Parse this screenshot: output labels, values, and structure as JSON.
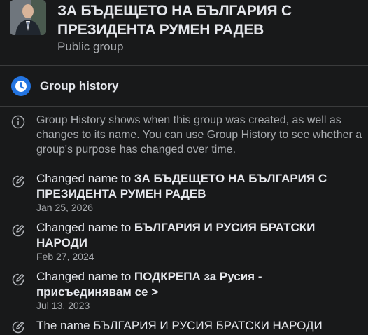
{
  "group": {
    "title": "ЗА БЪДЕЩЕТО НА БЪЛГАРИЯ С ПРЕЗИДЕНТА РУМЕН РАДЕВ",
    "privacy": "Public group"
  },
  "section": {
    "icon": "clock-icon",
    "title": "Group history"
  },
  "info": {
    "icon": "info-icon",
    "text": "Group History shows when this group was created, as well as changes to its name. You can use Group History to see whether a group's purpose has changed over time."
  },
  "history": [
    {
      "icon": "edit-icon",
      "prefix": "Changed name to ",
      "name": "ЗА БЪДЕЩЕТО НА БЪЛГАРИЯ С ПРЕЗИДЕНТА РУМЕН РАДЕВ",
      "date": "Jan 25, 2026"
    },
    {
      "icon": "edit-icon",
      "prefix": "Changed name to ",
      "name": "БЪЛГАРИЯ И РУСИЯ БРАТСКИ НАРОДИ",
      "date": "Feb 27, 2024"
    },
    {
      "icon": "edit-icon",
      "prefix": "Changed name to ",
      "name": "ПОДКРЕПА за Русия - присъединявам се >",
      "date": "Jul 13, 2023"
    }
  ],
  "partial_entry": {
    "icon": "edit-icon",
    "text": "The name БЪЛГАРИЯ И РУСИЯ БРАТСКИ НАРОДИ"
  },
  "colors": {
    "background": "#18191a",
    "accent": "#2374e1",
    "primary_text": "#e4e6eb",
    "secondary_text": "#a8abaf"
  }
}
